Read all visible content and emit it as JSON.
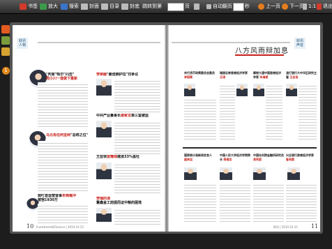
{
  "toolbar": {
    "bookmark": "书签",
    "zoom_in": "放大",
    "search": "搜索",
    "cover": "封面",
    "toc": "目录",
    "back_cover": "封底",
    "jump_label": "跳转到第",
    "page_unit": "页",
    "auto_flip": "自动翻页",
    "seconds": "秒",
    "prev_page": "上一页",
    "next_page": "下一页",
    "ratio": "1:1",
    "exit": "退出"
  },
  "side": {
    "badge": "1"
  },
  "left_page": {
    "tag_line1": "财讯",
    "tag_line2": "人物",
    "page_number": "10",
    "footer": "Investment&Finance | 2010.10.15",
    "articles": [
      {
        "title_black": "\"判官\"吸尔\"闪击\"",
        "title_red": "周小川一道做下重新"
      },
      {
        "title_black": "",
        "title_red": "马云再任阿里网",
        "title_black2": "\"总统之位\""
      },
      {
        "title_black": "郭叮首运营冒事",
        "title_red": "朱锦镯冲",
        "title_black2": "被宿1930万"
      },
      {
        "title_red": "李荣融",
        "title_black": "\"最佳拥护拉\"罚争议"
      },
      {
        "title_black": "中共产业董事长",
        "title_red": "谢家龙",
        "title_black2": "第三室被监"
      },
      {
        "title_black": "王亚领",
        "title_red": "宣耀城",
        "title_black2": "建涨33%盖社"
      },
      {
        "title_red": "李瑞的漂",
        "title_black": "董鑫金工前提而证中粮的困境"
      }
    ]
  },
  "right_page": {
    "big_title": "八方风雨辩加息",
    "tag_line1": "财讯",
    "tag_line2": "声音",
    "page_number": "11",
    "footer": "财讯 | 2010.10.15",
    "quotes": [
      {
        "title": "央行货币政策委员会委员",
        "name": "李稻葵"
      },
      {
        "title": "瑞银证券首席经济学家",
        "name": "汪涛"
      },
      {
        "title": "摩根大通中国首席经济学家",
        "name": "朱海斌"
      },
      {
        "title": "渣打银行大中华区研究主管",
        "name": "王志浩"
      },
      {
        "title": "国家统计局新闻发言人",
        "name": "盛来运"
      },
      {
        "title": "中国人民大学经济学院院长",
        "name": "杨瑞龙"
      },
      {
        "title": "中国社科院金融所研究员",
        "name": "易宪容"
      },
      {
        "title": "兴业银行首席经济学家",
        "name": "鲁政委"
      }
    ]
  }
}
